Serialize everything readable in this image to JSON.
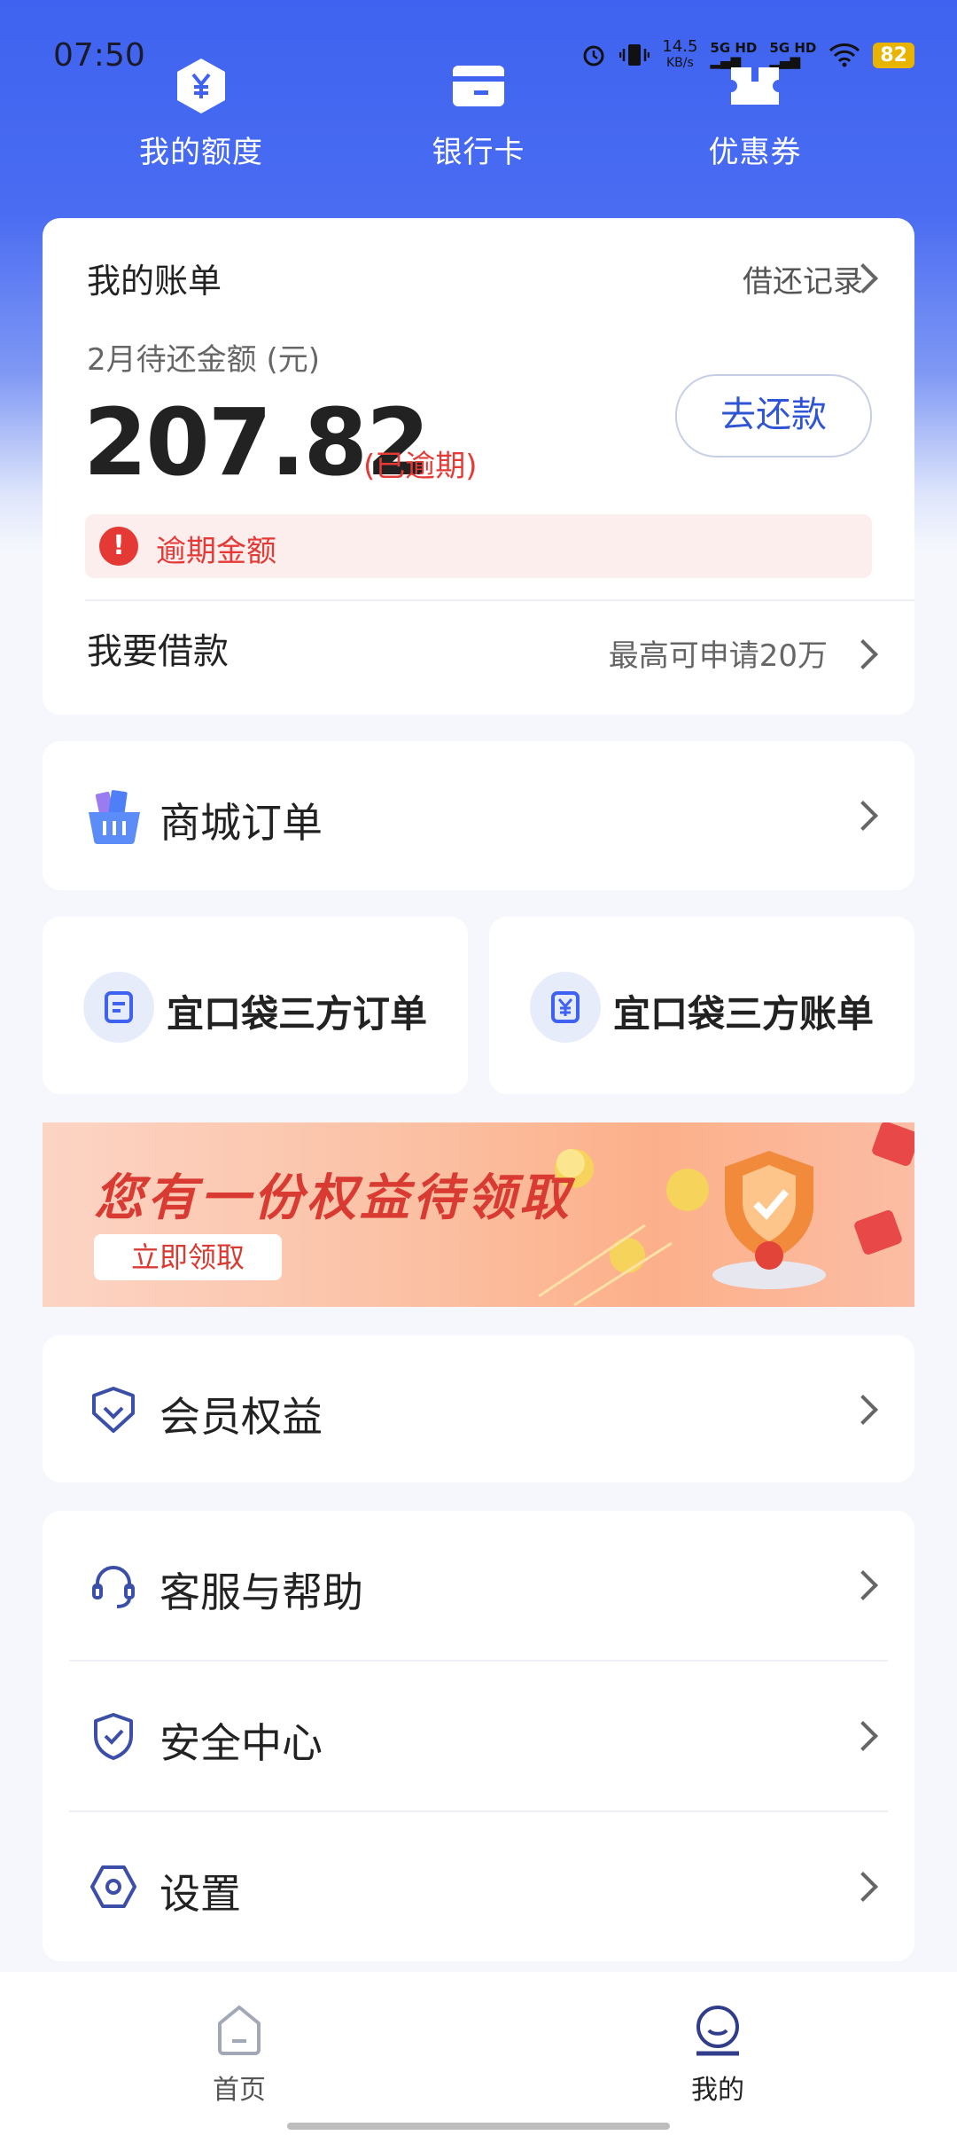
{
  "status_bar": {
    "time": "07:50",
    "network_speed": "14.5",
    "network_unit": "KB/s",
    "signal_1": "5G HD",
    "signal_2": "5G HD",
    "battery": "82"
  },
  "top_nav": {
    "items": [
      {
        "label": "我的额度",
        "icon": "yen-hexagon-icon"
      },
      {
        "label": "银行卡",
        "icon": "bank-card-icon"
      },
      {
        "label": "优惠券",
        "icon": "coupon-icon"
      }
    ]
  },
  "bill": {
    "title": "我的账单",
    "record_link": "借还记录",
    "month_label": "2月待还金额 (元)",
    "amount": "207.82",
    "overdue_tag": "(已逾期)",
    "repay_button": "去还款",
    "warning_text": "逾期金额",
    "warning_icon": "!",
    "borrow_title": "我要借款",
    "borrow_hint": "最高可申请20万"
  },
  "mall_order": {
    "label": "商城订单",
    "icon": "shopping-basket-icon"
  },
  "third_party": {
    "orders_label": "宜口袋三方订单",
    "bills_label": "宜口袋三方账单"
  },
  "banner": {
    "title": "您有一份权益待领取",
    "button": "立即领取"
  },
  "menu": {
    "member": "会员权益",
    "service": "客服与帮助",
    "security": "安全中心",
    "settings": "设置"
  },
  "bottom_tabs": {
    "home": "首页",
    "mine": "我的"
  },
  "colors": {
    "primary": "#3f63f0",
    "danger": "#e53935"
  }
}
